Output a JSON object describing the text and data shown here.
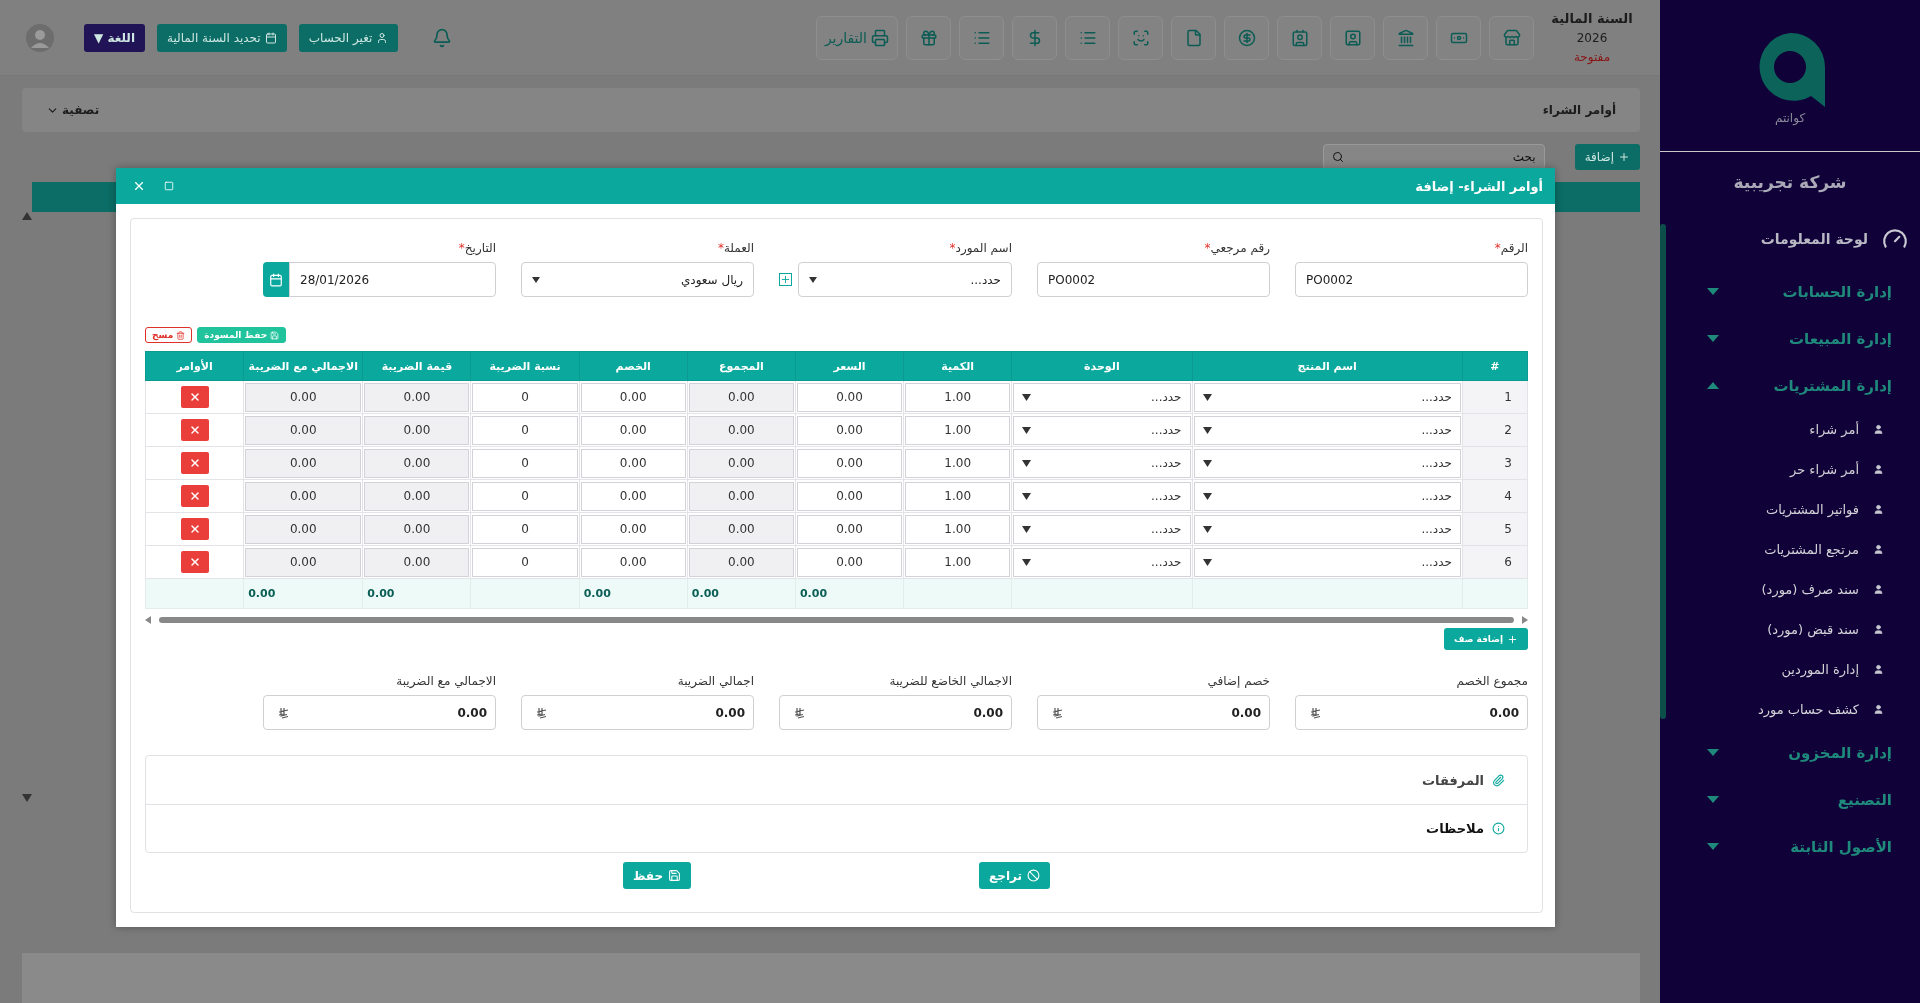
{
  "sidebar": {
    "logo_text": "كوانتم",
    "company": "شركة تجريبية",
    "items": [
      {
        "kind": "dashboard",
        "label": "لوحة المعلومات"
      },
      {
        "kind": "group",
        "label": "إدارة الحسابات",
        "expanded": false
      },
      {
        "kind": "group",
        "label": "إدارة المبيعات",
        "expanded": false
      },
      {
        "kind": "group",
        "label": "إدارة المشتريات",
        "expanded": true,
        "children": [
          {
            "label": "أمر شراء"
          },
          {
            "label": "أمر شراء حر"
          },
          {
            "label": "فواتير المشتريات"
          },
          {
            "label": "مرتجع المشتريات"
          },
          {
            "label": "سند صرف (مورد)"
          },
          {
            "label": "سند قبض (مورد)"
          },
          {
            "label": "إدارة الموردين"
          },
          {
            "label": "كشف حساب مورد"
          }
        ]
      },
      {
        "kind": "group",
        "label": "إدارة المخزون",
        "expanded": false
      },
      {
        "kind": "group",
        "label": "التصنيع",
        "expanded": false
      },
      {
        "kind": "group",
        "label": "الأصول الثابتة",
        "expanded": false
      }
    ]
  },
  "topbar": {
    "fiscal_year": {
      "label": "السنة المالية",
      "year": "2026",
      "status": "مفتوحة"
    },
    "reports_button": "التقارير",
    "account_button": "تغير الحساب",
    "fiscal_button": "تحديد السنة المالية",
    "language_button": {
      "label": "اللغة",
      "caret": "▼"
    }
  },
  "page": {
    "title": "أوامر الشراء",
    "filter": "تصفية",
    "add_button": "إضافة",
    "search": {
      "placeholder": "بحث"
    }
  },
  "modal": {
    "title": "أوامر الشراء- إضافة",
    "fields": [
      {
        "kind": "text",
        "label": "الرقم",
        "required_mark": "*",
        "value": "PO0002"
      },
      {
        "kind": "text",
        "label": "رقم مرجعي",
        "required_mark": "*",
        "value": "PO0002"
      },
      {
        "kind": "select",
        "label": "اسم المورد",
        "required_mark": "*",
        "value": "حدد...",
        "addon": true
      },
      {
        "kind": "select",
        "label": "العملة",
        "required_mark": "*",
        "value": "ريال سعودي"
      },
      {
        "kind": "date",
        "label": "التاريخ",
        "required_mark": "*",
        "value": "28/01/2026"
      }
    ],
    "draft_button": "حفظ المسودة",
    "clear_button": "مسح",
    "table": {
      "columns": [
        {
          "label": "#",
          "kind": "index"
        },
        {
          "label": "اسم المنتج",
          "kind": "select"
        },
        {
          "label": "الوحدة",
          "kind": "select"
        },
        {
          "label": "الكمية",
          "kind": "input",
          "readonly": false
        },
        {
          "label": "السعر",
          "kind": "input",
          "readonly": false,
          "total": "0.00"
        },
        {
          "label": "المجموع",
          "kind": "input",
          "readonly": true,
          "total": "0.00"
        },
        {
          "label": "الخصم",
          "kind": "input",
          "readonly": false,
          "total": "0.00"
        },
        {
          "label": "نسبة الضريبة",
          "kind": "input",
          "readonly": false
        },
        {
          "label": "قيمة الضريبة",
          "kind": "input",
          "readonly": true,
          "total": "0.00"
        },
        {
          "label": "الاجمالي مع الضريبة",
          "kind": "input",
          "readonly": true,
          "total": "0.00"
        },
        {
          "label": "الأوامر",
          "kind": "actions"
        }
      ],
      "rows": [
        [
          "1",
          "حدد...",
          "حدد...",
          "1.00",
          "0.00",
          "0.00",
          "0.00",
          "0",
          "0.00",
          "0.00",
          null
        ],
        [
          "2",
          "حدد...",
          "حدد...",
          "1.00",
          "0.00",
          "0.00",
          "0.00",
          "0",
          "0.00",
          "0.00",
          null
        ],
        [
          "3",
          "حدد...",
          "حدد...",
          "1.00",
          "0.00",
          "0.00",
          "0.00",
          "0",
          "0.00",
          "0.00",
          null
        ],
        [
          "4",
          "حدد...",
          "حدد...",
          "1.00",
          "0.00",
          "0.00",
          "0.00",
          "0",
          "0.00",
          "0.00",
          null
        ],
        [
          "5",
          "حدد...",
          "حدد...",
          "1.00",
          "0.00",
          "0.00",
          "0.00",
          "0",
          "0.00",
          "0.00",
          null
        ],
        [
          "6",
          "حدد...",
          "حدد...",
          "1.00",
          "0.00",
          "0.00",
          "0.00",
          "0",
          "0.00",
          "0.00",
          null
        ]
      ]
    },
    "add_row_button": "إضافة صف",
    "summary": [
      {
        "label": "مجموع الخصم",
        "value": "0.00"
      },
      {
        "label": "خصم إضافي",
        "value": "0.00"
      },
      {
        "label": "الاجمالي الخاضع للضريبة",
        "value": "0.00"
      },
      {
        "label": "اجمالي الضريبة",
        "value": "0.00"
      },
      {
        "label": "الاجمالي مع الضريبة",
        "value": "0.00"
      }
    ],
    "sections": [
      {
        "kind": "attachments",
        "label": "المرفقات"
      },
      {
        "kind": "notes",
        "label": "ملاحظات"
      }
    ],
    "cancel_button": "تراجع",
    "save_button": "حفظ"
  }
}
